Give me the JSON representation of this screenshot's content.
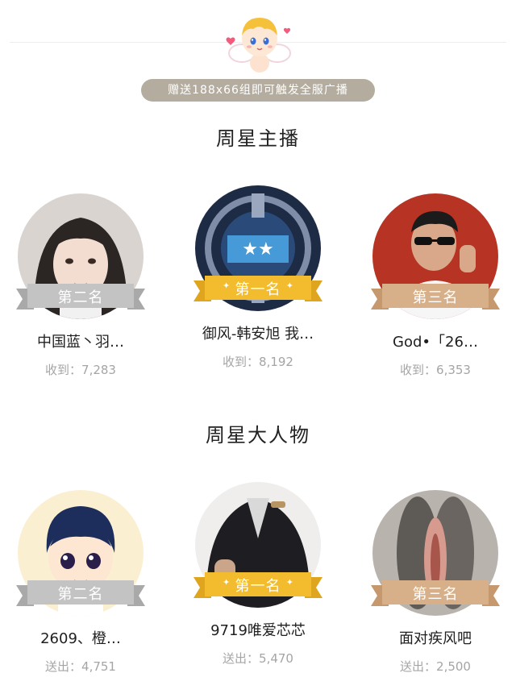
{
  "header": {
    "broadcast_text": "赠送188x66组即可触发全服广播"
  },
  "anchors": {
    "title": "周星主播",
    "cards": [
      {
        "rank_label": "第二名",
        "name": "中国蓝丶羽…",
        "amount_label": "收到：",
        "amount": "7,283"
      },
      {
        "rank_label": "第一名",
        "name": "御风-韩安旭 我…",
        "amount_label": "收到：",
        "amount": "8,192"
      },
      {
        "rank_label": "第三名",
        "name": "God•「26…",
        "amount_label": "收到：",
        "amount": "6,353"
      }
    ]
  },
  "vips": {
    "title": "周星大人物",
    "cards": [
      {
        "rank_label": "第二名",
        "name": "2609、橙…",
        "amount_label": "送出：",
        "amount": "4,751"
      },
      {
        "rank_label": "第一名",
        "name": "9719唯爱芯芯",
        "amount_label": "送出：",
        "amount": "5,470"
      },
      {
        "rank_label": "第三名",
        "name": "面对疾风吧",
        "amount_label": "送出：",
        "amount": "2,500"
      }
    ]
  },
  "colors": {
    "gold": "#f2bc2e",
    "silver": "#bcbcbc",
    "bronze": "#d7b08a",
    "pill": "#b4ad9f"
  },
  "icons": [
    "cupid-icon"
  ]
}
